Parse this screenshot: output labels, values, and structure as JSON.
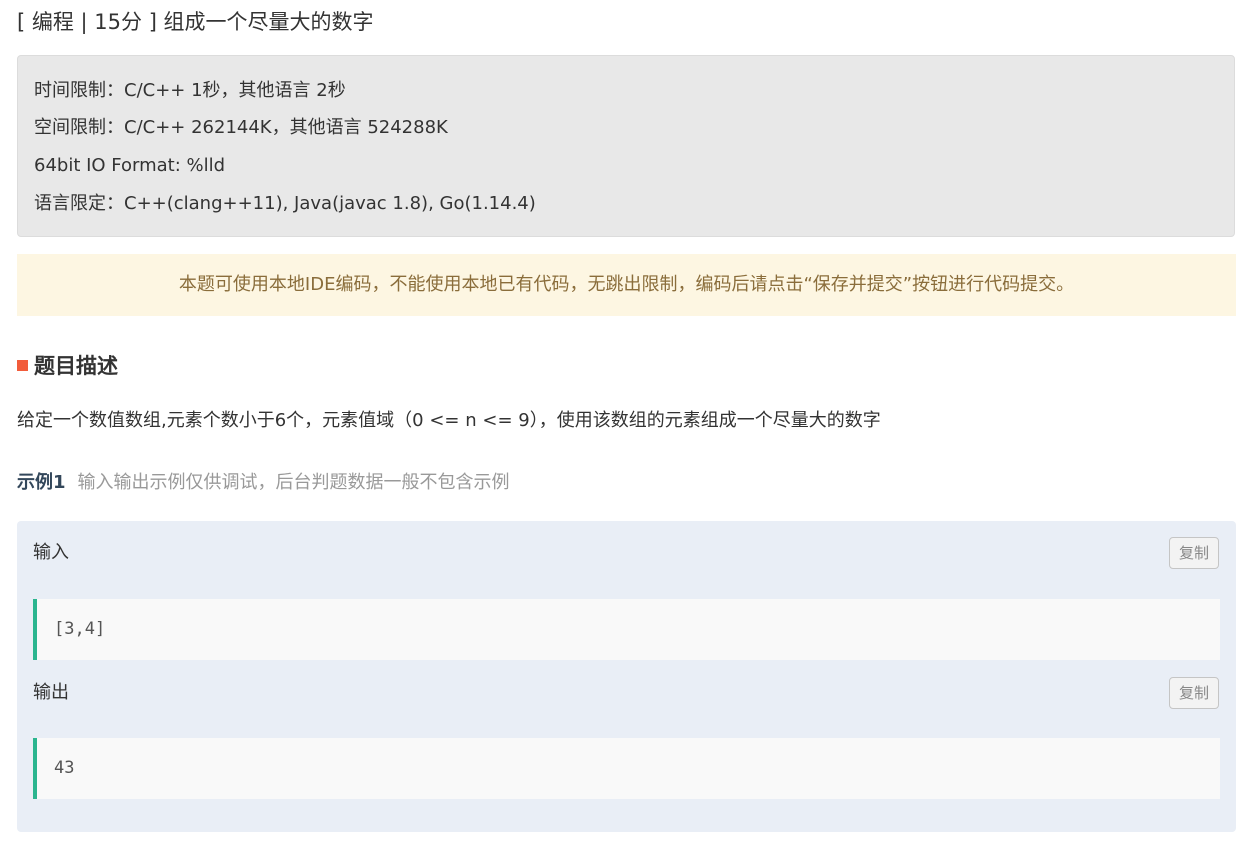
{
  "header": {
    "title": "[ 编程 | 15分 ] 组成一个尽量大的数字"
  },
  "limits": {
    "time": "时间限制：C/C++ 1秒，其他语言 2秒",
    "space": "空间限制：C/C++ 262144K，其他语言 524288K",
    "io_format": "64bit IO Format: %lld",
    "languages": "语言限定：C++(clang++11), Java(javac 1.8), Go(1.14.4)"
  },
  "notice": {
    "text": "本题可使用本地IDE编码，不能使用本地已有代码，无跳出限制，编码后请点击“保存并提交”按钮进行代码提交。"
  },
  "description": {
    "heading": "题目描述",
    "body": "给定一个数值数组,元素个数小于6个，元素值域（0 <= n <= 9），使用该数组的元素组成一个尽量大的数字"
  },
  "example": {
    "title": "示例1",
    "note": "输入输出示例仅供调试，后台判题数据一般不包含示例",
    "input_label": "输入",
    "input_value": "[3,4]",
    "output_label": "输出",
    "output_value": "43",
    "copy_label": "复制"
  },
  "colors": {
    "section_bullet": "#f25c3b",
    "code_accent": "#2bb58f",
    "notice_bg": "#fdf6e2",
    "notice_text": "#8a6d3b",
    "example_bg": "#e9eef6"
  }
}
